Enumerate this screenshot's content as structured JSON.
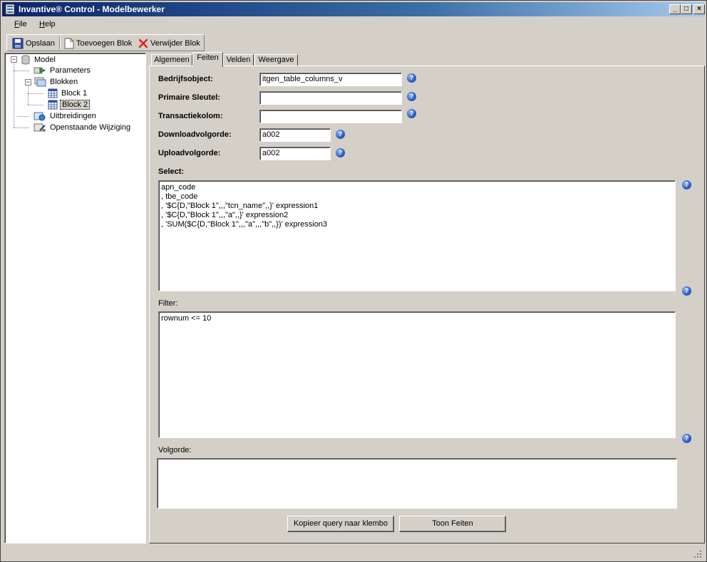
{
  "window": {
    "title": "Invantive® Control - Modelbewerker",
    "controls": {
      "minimize": "_",
      "maximize": "□",
      "close": "×"
    }
  },
  "menu": {
    "items": [
      {
        "label": "File",
        "accel": "F",
        "rest": "ile"
      },
      {
        "label": "Help",
        "accel": "H",
        "rest": "elp"
      }
    ]
  },
  "toolbar": {
    "save_label": "Opslaan",
    "add_block_label": "Toevoegen Blok",
    "remove_block_label": "Verwijder Blok"
  },
  "tree": {
    "root": "Model",
    "items": [
      {
        "label": "Parameters",
        "icon": "parameters-icon"
      },
      {
        "label": "Blokken",
        "icon": "blocks-icon"
      },
      {
        "label": "Block 1",
        "icon": "table-icon"
      },
      {
        "label": "Block 2",
        "icon": "table-icon",
        "selected": true
      },
      {
        "label": "Uitbreidingen",
        "icon": "extensions-icon"
      },
      {
        "label": "Openstaande Wijziging",
        "icon": "pending-changes-icon"
      }
    ],
    "expander_minus": "−"
  },
  "tabs": [
    {
      "label": "Algemeen"
    },
    {
      "label": "Feiten",
      "active": true
    },
    {
      "label": "Velden"
    },
    {
      "label": "Weergave"
    }
  ],
  "form": {
    "bedrijfsobject": {
      "label": "Bedrijfsobject:",
      "value": "itgen_table_columns_v"
    },
    "primaire_sleutel": {
      "label": "Primaire Sleutel:",
      "value": ""
    },
    "transactiekolom": {
      "label": "Transactiekolom:",
      "value": ""
    },
    "downloadvolgorde": {
      "label": "Downloadvolgorde:",
      "value": "a002"
    },
    "uploadvolgorde": {
      "label": "Uploadvolgorde:",
      "value": "a002"
    },
    "select": {
      "label": "Select:",
      "value": "apn_code\n, tbe_code\n, '$C{D,\"Block 1\",,,\"tcn_name\",,}' expression1\n, '$C{D,\"Block 1\",,,\"a\",,}' expression2\n, 'SUM($C{D,\"Block 1\",,,\"a\",,,\"b\",,})' expression3"
    },
    "filter": {
      "label": "Filter:",
      "value": "rownum <= 10"
    },
    "volgorde": {
      "label": "Volgorde:",
      "value": ""
    },
    "help_glyph": "?"
  },
  "buttons": {
    "copy_query": "Kopieer  query  naar klembo",
    "show_facts": "Toon Feiten"
  }
}
